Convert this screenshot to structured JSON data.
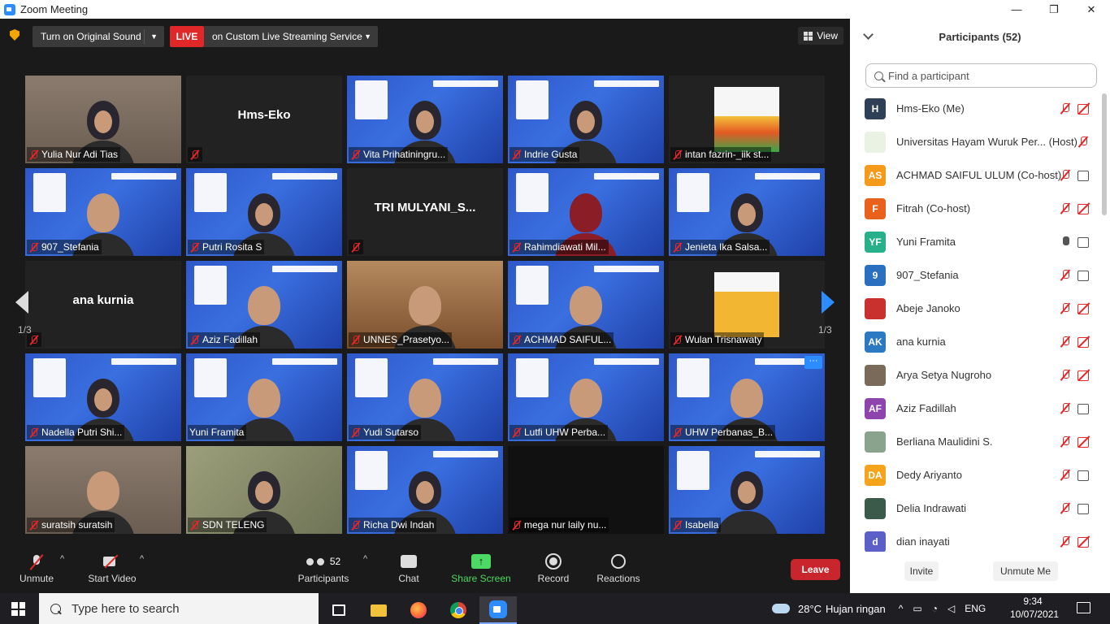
{
  "window": {
    "title": "Zoom Meeting",
    "minimize": "—",
    "maximize": "❐",
    "close": "✕"
  },
  "topbar": {
    "original_sound": "Turn on Original Sound",
    "live": "LIVE",
    "stream_service": "on Custom Live Streaming Service",
    "view": "View"
  },
  "grid": {
    "page_indicator": "1/3",
    "tiles": [
      {
        "name": "Yulia Nur Adi Tias",
        "bg": "home"
      },
      {
        "name": "",
        "big": "Hms-Eko",
        "bg": "dark"
      },
      {
        "name": "Vita Prihatiningru...",
        "bg": "slide"
      },
      {
        "name": "Indrie Gusta",
        "bg": "slide"
      },
      {
        "name": "intan fazrin-_iik st...",
        "bg": "dark",
        "avatar": "success"
      },
      {
        "name": "907_Stefania",
        "bg": "slide"
      },
      {
        "name": "Putri Rosita S",
        "bg": "slide"
      },
      {
        "name": "",
        "big": "TRI MULYANI_S...",
        "bg": "dark"
      },
      {
        "name": "Rahimdiawati Mil...",
        "bg": "slide"
      },
      {
        "name": "Jenieta Ika Salsa...",
        "bg": "slide"
      },
      {
        "name": "",
        "big": "ana kurnia",
        "bg": "dark"
      },
      {
        "name": "Aziz Fadillah",
        "bg": "slide"
      },
      {
        "name": "UNNES_Prasetyo...",
        "bg": "wood"
      },
      {
        "name": "ACHMAD SAIFUL...",
        "bg": "slide"
      },
      {
        "name": "Wulan Trisnawaty",
        "bg": "dark",
        "avatar": "wulan"
      },
      {
        "name": "Nadella Putri Shi...",
        "bg": "slide"
      },
      {
        "name": "Yuni Framita",
        "bg": "slide",
        "active": true
      },
      {
        "name": "Yudi Sutarso",
        "bg": "slide"
      },
      {
        "name": "Lutfi UHW Perba...",
        "bg": "slide"
      },
      {
        "name": "UHW Perbanas_B...",
        "bg": "slide",
        "dots": "···"
      },
      {
        "name": "suratsih suratsih",
        "bg": "home"
      },
      {
        "name": "SDN TELENG",
        "bg": "green"
      },
      {
        "name": "Richa Dwi Indah",
        "bg": "slide"
      },
      {
        "name": "mega nur laily nu...",
        "bg": "blackish"
      },
      {
        "name": "Isabella",
        "bg": "slide"
      }
    ]
  },
  "toolbar": {
    "unmute": "Unmute",
    "start_video": "Start Video",
    "participants": "Participants",
    "participants_count": "52",
    "chat": "Chat",
    "share_screen": "Share Screen",
    "record": "Record",
    "reactions": "Reactions",
    "leave": "Leave",
    "share_arrow": "↑",
    "caret": "^"
  },
  "panel": {
    "title": "Participants (52)",
    "search_placeholder": "Find a participant",
    "invite": "Invite",
    "unmute_me": "Unmute Me",
    "participants": [
      {
        "initials": "H",
        "name": "Hms-Eko (Me)",
        "color": "#2f3f55",
        "mic": "muted",
        "cam": "off"
      },
      {
        "initials": "",
        "name": "Universitas Hayam Wuruk Per... (Host)",
        "color": "#e9f2e3",
        "mic": "muted",
        "cam": "none"
      },
      {
        "initials": "AS",
        "name": "ACHMAD SAIFUL ULUM (Co-host)",
        "color": "#f59a1a",
        "mic": "muted",
        "cam": "on"
      },
      {
        "initials": "F",
        "name": "Fitrah (Co-host)",
        "color": "#e8621d",
        "mic": "muted",
        "cam": "off"
      },
      {
        "initials": "YF",
        "name": "Yuni Framita",
        "color": "#27b08a",
        "mic": "on",
        "cam": "on"
      },
      {
        "initials": "9",
        "name": "907_Stefania",
        "color": "#2a6fc0",
        "mic": "muted",
        "cam": "on"
      },
      {
        "initials": "",
        "name": "Abeje Janoko",
        "color": "#c9312e",
        "mic": "muted",
        "cam": "off"
      },
      {
        "initials": "AK",
        "name": "ana kurnia",
        "color": "#2a79c2",
        "mic": "muted",
        "cam": "off"
      },
      {
        "initials": "",
        "name": "Arya Setya Nugroho",
        "color": "#7a6a5a",
        "mic": "muted",
        "cam": "off"
      },
      {
        "initials": "AF",
        "name": "Aziz Fadillah",
        "color": "#8e44ad",
        "mic": "muted",
        "cam": "on"
      },
      {
        "initials": "",
        "name": "Berliana Maulidini S.",
        "color": "#8aa38c",
        "mic": "muted",
        "cam": "off"
      },
      {
        "initials": "DA",
        "name": "Dedy Ariyanto",
        "color": "#f5a31a",
        "mic": "muted",
        "cam": "on"
      },
      {
        "initials": "",
        "name": "Delia Indrawati",
        "color": "#3b5a4a",
        "mic": "muted",
        "cam": "on"
      },
      {
        "initials": "d",
        "name": "dian inayati",
        "color": "#5b5fc7",
        "mic": "muted",
        "cam": "off"
      }
    ]
  },
  "taskbar": {
    "search_placeholder": "Type here to search",
    "temperature": "28°C",
    "weather": "Hujan ringan",
    "language": "ENG",
    "time": "9:34",
    "date": "10/07/2021",
    "tray_up": "^"
  }
}
